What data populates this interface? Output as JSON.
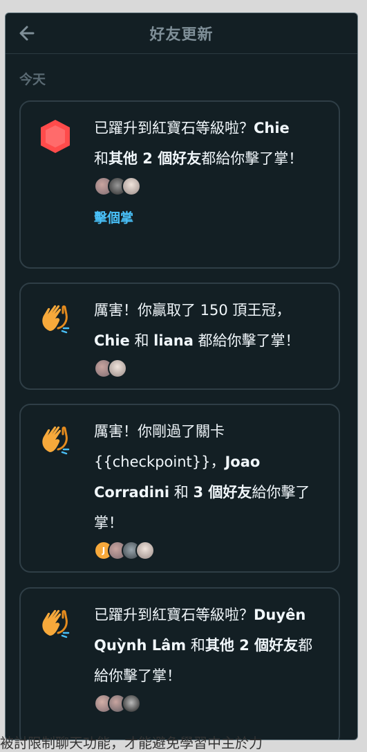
{
  "header": {
    "title": "好友更新"
  },
  "section_label": "今天",
  "cards": [
    {
      "parts": [
        "已躍升到紅寶石等級啦？",
        "Chie",
        "和",
        "其他 2 個好友",
        "都給你擊了掌！"
      ],
      "action": "擊個掌"
    },
    {
      "parts": [
        "厲害！你贏取了 150 頂王冠，",
        "Chie",
        " 和 ",
        "liana",
        " 都給你擊了掌！"
      ]
    },
    {
      "parts": [
        "厲害！你剛過了關卡 {{checkpoint}}，",
        "Joao Corradini",
        " 和 ",
        "3 個好友",
        "給你擊了掌！"
      ]
    },
    {
      "parts": [
        "已躍升到紅寶石等級啦？",
        "Duyên Quỳnh Lâm",
        " 和",
        "其他 2 個好友",
        "都給你擊了掌！"
      ]
    }
  ],
  "avatar_initial": "J",
  "background_text": "被討限制聊天功能，才能避免學習中主於力",
  "colors": {
    "accent": "#49c0f8",
    "ruby": "#ff4b4b",
    "clap": "#f7a93b"
  }
}
